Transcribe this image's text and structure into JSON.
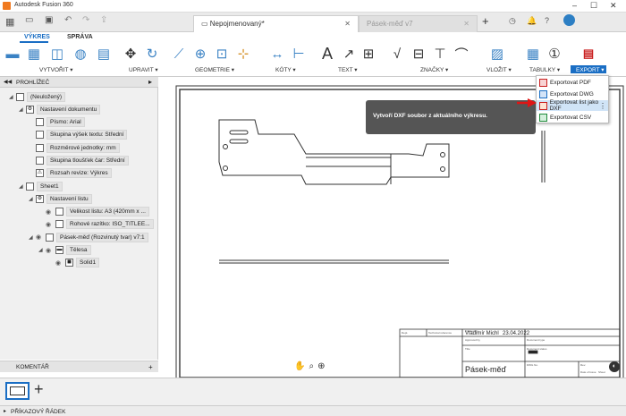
{
  "app": {
    "title": "Autodesk Fusion 360"
  },
  "tabs": [
    {
      "label": "Nepojmenovaný*",
      "active": true
    },
    {
      "label": "Pásek-měď v7",
      "active": false
    }
  ],
  "ribbon": {
    "tabs": [
      "VÝKRES",
      "SPRÁVA"
    ],
    "groups": [
      "VYTVOŘIT ▾",
      "UPRAVIT ▾",
      "GEOMETRIE ▾",
      "KÓTY ▾",
      "TEXT ▾",
      "ZNAČKY ▾",
      "VLOŽIT ▾",
      "TABULKY ▾",
      "EXPORT ▾"
    ]
  },
  "browser": {
    "header": "PROHLÍŽEČ",
    "items": [
      {
        "label": "(Neuložený)",
        "level": 0
      },
      {
        "label": "Nastavení dokumentu",
        "level": 1
      },
      {
        "label": "Písmo: Arial",
        "level": 2
      },
      {
        "label": "Skupina výšek textu: Střední",
        "level": 2
      },
      {
        "label": "Rozměrové jednotky: mm",
        "level": 2
      },
      {
        "label": "Skupina tloušťek čar: Střední",
        "level": 2
      },
      {
        "label": "Rozsah revize: Výkres",
        "level": 2
      },
      {
        "label": "Sheet1",
        "level": 1
      },
      {
        "label": "Nastavení listu",
        "level": 2
      },
      {
        "label": "Velikost listu: A3 (420mm x ...",
        "level": 3
      },
      {
        "label": "Rohové razítko: ISO_TITLEE...",
        "level": 3
      },
      {
        "label": "Pásek-měď (Rozvinutý tvar) v7:1",
        "level": 2
      },
      {
        "label": "Tělesa",
        "level": 3
      },
      {
        "label": "Solid1",
        "level": 4
      }
    ],
    "comments": "KOMENTÁŘ"
  },
  "export_menu": {
    "items": [
      "Exportovat PDF",
      "Exportovat DWG",
      "Exportovat list jako DXF",
      "Exportovat CSV"
    ],
    "highlighted": 2
  },
  "tooltip": "Vytvoří DXF soubor z aktuálního výkresu.",
  "titleblock": {
    "name": "Vladimír Michl",
    "date": "23.04.2022",
    "part": "Pásek-měď",
    "small": [
      "Dept.",
      "Technical reference",
      "Created by",
      "Approved by",
      "Document type",
      "Document status",
      "Title",
      "DWG No.",
      "Rev.",
      "Date of issue",
      "Sheet"
    ]
  },
  "command_line": "PŘÍKAZOVÝ ŘÁDEK"
}
